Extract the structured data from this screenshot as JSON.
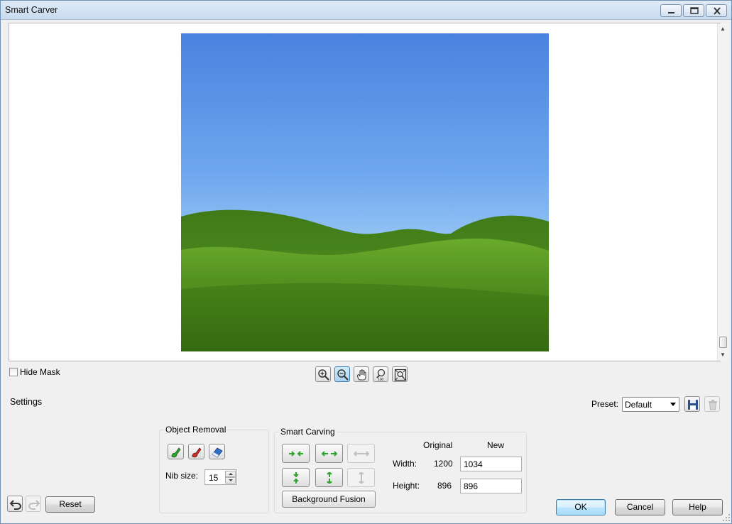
{
  "window": {
    "title": "Smart Carver"
  },
  "view": {
    "hide_mask_label": "Hide Mask"
  },
  "zoom_tools": [
    "zoom-in",
    "zoom-out",
    "pan",
    "zoom-100",
    "fit-to-window"
  ],
  "settings": {
    "label": "Settings",
    "preset_label": "Preset:",
    "preset_value": "Default"
  },
  "object_removal": {
    "title": "Object Removal",
    "nib_label": "Nib size:",
    "nib_value": "15"
  },
  "smart_carving": {
    "title": "Smart Carving",
    "background_fusion": "Background Fusion",
    "original_header": "Original",
    "new_header": "New",
    "width_label": "Width:",
    "width_original": "1200",
    "width_new": "1034",
    "height_label": "Height:",
    "height_original": "896",
    "height_new": "896"
  },
  "buttons": {
    "reset": "Reset",
    "ok": "OK",
    "cancel": "Cancel",
    "help": "Help"
  },
  "colors": {
    "sky_top": "#4c85e2",
    "sky_bottom": "#a6d1f7",
    "grass": "#4e8a1c",
    "accent_green": "#2fa52f",
    "accent_red": "#c8302a",
    "accent_blue": "#2f6fc9"
  }
}
